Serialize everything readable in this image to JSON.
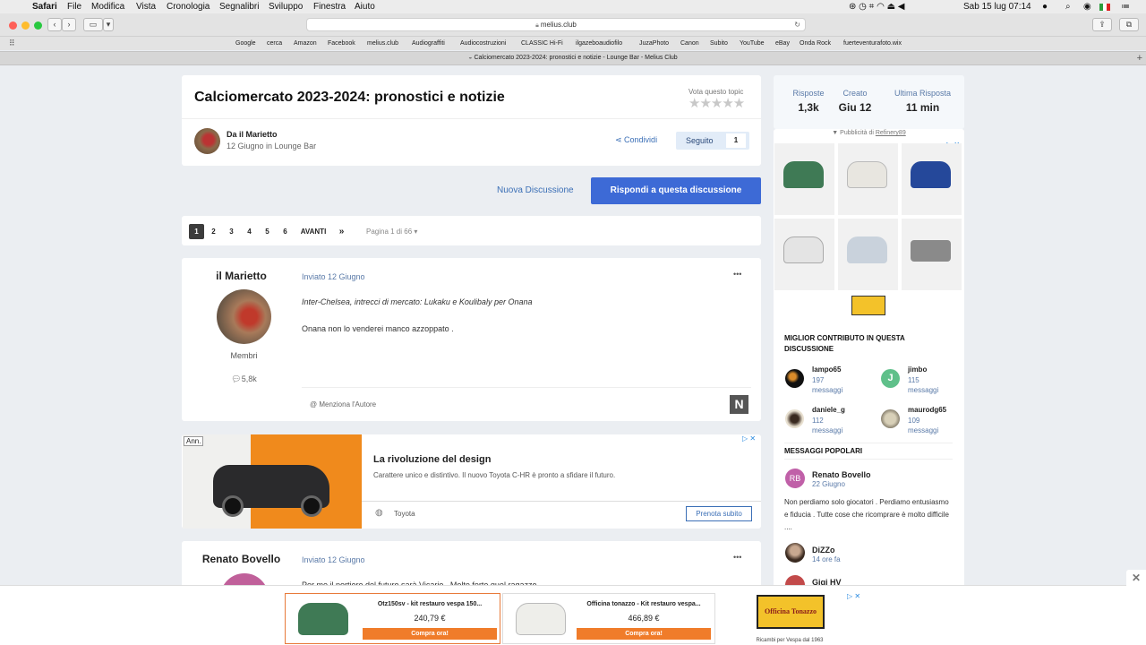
{
  "menubar": {
    "app": "Safari",
    "items": [
      "File",
      "Modifica",
      "Vista",
      "Cronologia",
      "Segnalibri",
      "Sviluppo",
      "Finestra",
      "Aiuto"
    ],
    "clock": "Sab 15 lug  07:14"
  },
  "browser": {
    "url": "melius.club",
    "favorites": [
      "Google",
      "cerca",
      "Amazon",
      "Facebook",
      "melius.club",
      "Audiograffiti",
      "Audiocostruzioni",
      "CLASSIC Hi-Fi",
      "ilgazeboaudiofilo",
      "JuzaPhoto",
      "Canon",
      "Subito",
      "YouTube",
      "eBay",
      "Onda Rock",
      "fuerteventurafoto.wix"
    ],
    "tab_title": "Calciomercato 2023-2024: pronostici e notizie - Lounge Bar - Melius Club"
  },
  "topic": {
    "title": "Calciomercato 2023-2024: pronostici e notizie",
    "rate_label": "Vota questo topic",
    "stars": "★★★★★",
    "author_line": "Da il Marietto",
    "date_line": "12 Giugno in Lounge Bar",
    "share_label": "Condividi",
    "follow_label": "Seguito",
    "follow_count": "1"
  },
  "actions": {
    "new_discussion": "Nuova Discussione",
    "reply": "Rispondi a questa discussione"
  },
  "pagination": {
    "pages": [
      "1",
      "2",
      "3",
      "4",
      "5",
      "6"
    ],
    "next": "AVANTI",
    "last": "»",
    "page_info": "Pagina 1 di 66"
  },
  "post1": {
    "author": "il Marietto",
    "role": "Membri",
    "posts": "5,8k",
    "date": "Inviato 12 Giugno",
    "more": "•••",
    "quote": "Inter-Chelsea, intrecci di mercato: Lukaku e Koulibaly per Onana",
    "body": "Onana non lo venderei manco azzoppato .",
    "mention": "Menziona l'Autore"
  },
  "ad": {
    "tag": "Ann.",
    "headline": "La rivoluzione del design",
    "text": "Carattere unico e distintivo. Il nuovo Toyota C-HR è pronto a sfidare il futuro.",
    "brand": "Toyota",
    "cta": "Prenota subito"
  },
  "post2": {
    "author": "Renato Bovello",
    "date": "Inviato 12 Giugno",
    "more": "•••",
    "snippet": "Per me il portiere del futuro sarà Vicario . Molto forte quel ragazzo"
  },
  "sidebar": {
    "stats": [
      {
        "label": "Risposte",
        "value": "1,3k"
      },
      {
        "label": "Creato",
        "value": "Giu 12"
      },
      {
        "label": "Ultima Risposta",
        "value": "11 min"
      }
    ],
    "sponsor_prefix": "▼ Pubblicità di",
    "sponsor_name": "Refinery89",
    "best_title": "MIGLIOR CONTRIBUTO IN QUESTA DISCUSSIONE",
    "contributors": [
      {
        "name": "lampo65",
        "count": "197",
        "unit": "messaggi"
      },
      {
        "name": "jimbo",
        "count": "115",
        "unit": "messaggi"
      },
      {
        "name": "daniele_g",
        "count": "112",
        "unit": "messaggi"
      },
      {
        "name": "maurodg65",
        "count": "109",
        "unit": "messaggi"
      }
    ],
    "popular_title": "MESSAGGI POPOLARI",
    "popular": [
      {
        "initials": "RB",
        "name": "Renato Bovello",
        "date": "22 Giugno",
        "text": "Non perdiamo solo giocatori . Perdiamo entusiasmo e fiducia . Tutte cose che ricomprare è molto difficile ...."
      },
      {
        "name": "DiZZo",
        "date": "14 ore fa"
      },
      {
        "name": "Gigi HV"
      }
    ]
  },
  "bottom_ad": {
    "items": [
      {
        "title": "Otz150sv - kit restauro vespa 150...",
        "price": "240,79 €",
        "cta": "Compra ora!"
      },
      {
        "title": "Officina tonazzo - Kit restauro vespa...",
        "price": "466,89 €",
        "cta": "Compra ora!"
      }
    ],
    "brand": "Officina Tonazzo",
    "brand_sub": "Ricambi per Vespa dal 1963"
  },
  "colors": {
    "accent": "#3d6ad6",
    "link": "#3b6fb6",
    "bg": "#ebeef2"
  }
}
